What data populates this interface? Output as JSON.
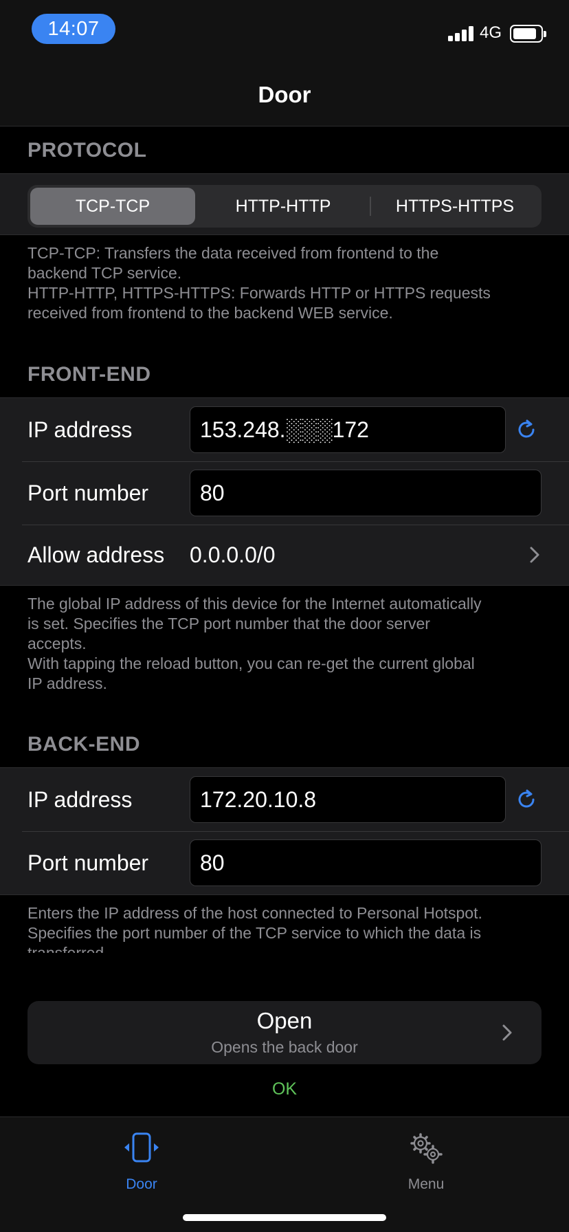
{
  "status_bar": {
    "time": "14:07",
    "network": "4G"
  },
  "nav": {
    "title": "Door"
  },
  "protocol": {
    "header": "PROTOCOL",
    "segments": [
      "TCP-TCP",
      "HTTP-HTTP",
      "HTTPS-HTTPS"
    ],
    "selected": "TCP-TCP",
    "footnote_lines": [
      "TCP-TCP: Transfers the data received from frontend to the",
      "backend TCP service.",
      "HTTP-HTTP, HTTPS-HTTPS: Forwards HTTP or HTTPS requests",
      "received from frontend to the backend WEB service."
    ]
  },
  "front_end": {
    "header": "FRONT-END",
    "ip_label": "IP address",
    "ip_value": "153.248.░░░172",
    "port_label": "Port number",
    "port_value": "80",
    "allow_label": "Allow address",
    "allow_value": "0.0.0.0/0",
    "footnote_lines": [
      "The global IP address of this device for the Internet automatically",
      "is set. Specifies the TCP port number that the door server",
      "accepts.",
      "With tapping the reload button, you can re-get the current global",
      "IP address."
    ]
  },
  "back_end": {
    "header": "BACK-END",
    "ip_label": "IP address",
    "ip_value": "172.20.10.8",
    "port_label": "Port number",
    "port_value": "80",
    "footnote_lines": [
      "Enters the IP address of the host connected to Personal Hotspot.",
      "Specifies the port number of the TCP service to which the data is",
      "transferred."
    ]
  },
  "open_button": {
    "title": "Open",
    "subtitle": "Opens the back door"
  },
  "status_message": "OK",
  "tab_bar": {
    "tabs": [
      {
        "label": "Door",
        "icon": "door-icon",
        "active": true
      },
      {
        "label": "Menu",
        "icon": "gears-icon",
        "active": false
      }
    ]
  },
  "colors": {
    "accent": "#3a84f2",
    "ok": "#5fc35a",
    "secondary_text": "#8e8e93"
  }
}
